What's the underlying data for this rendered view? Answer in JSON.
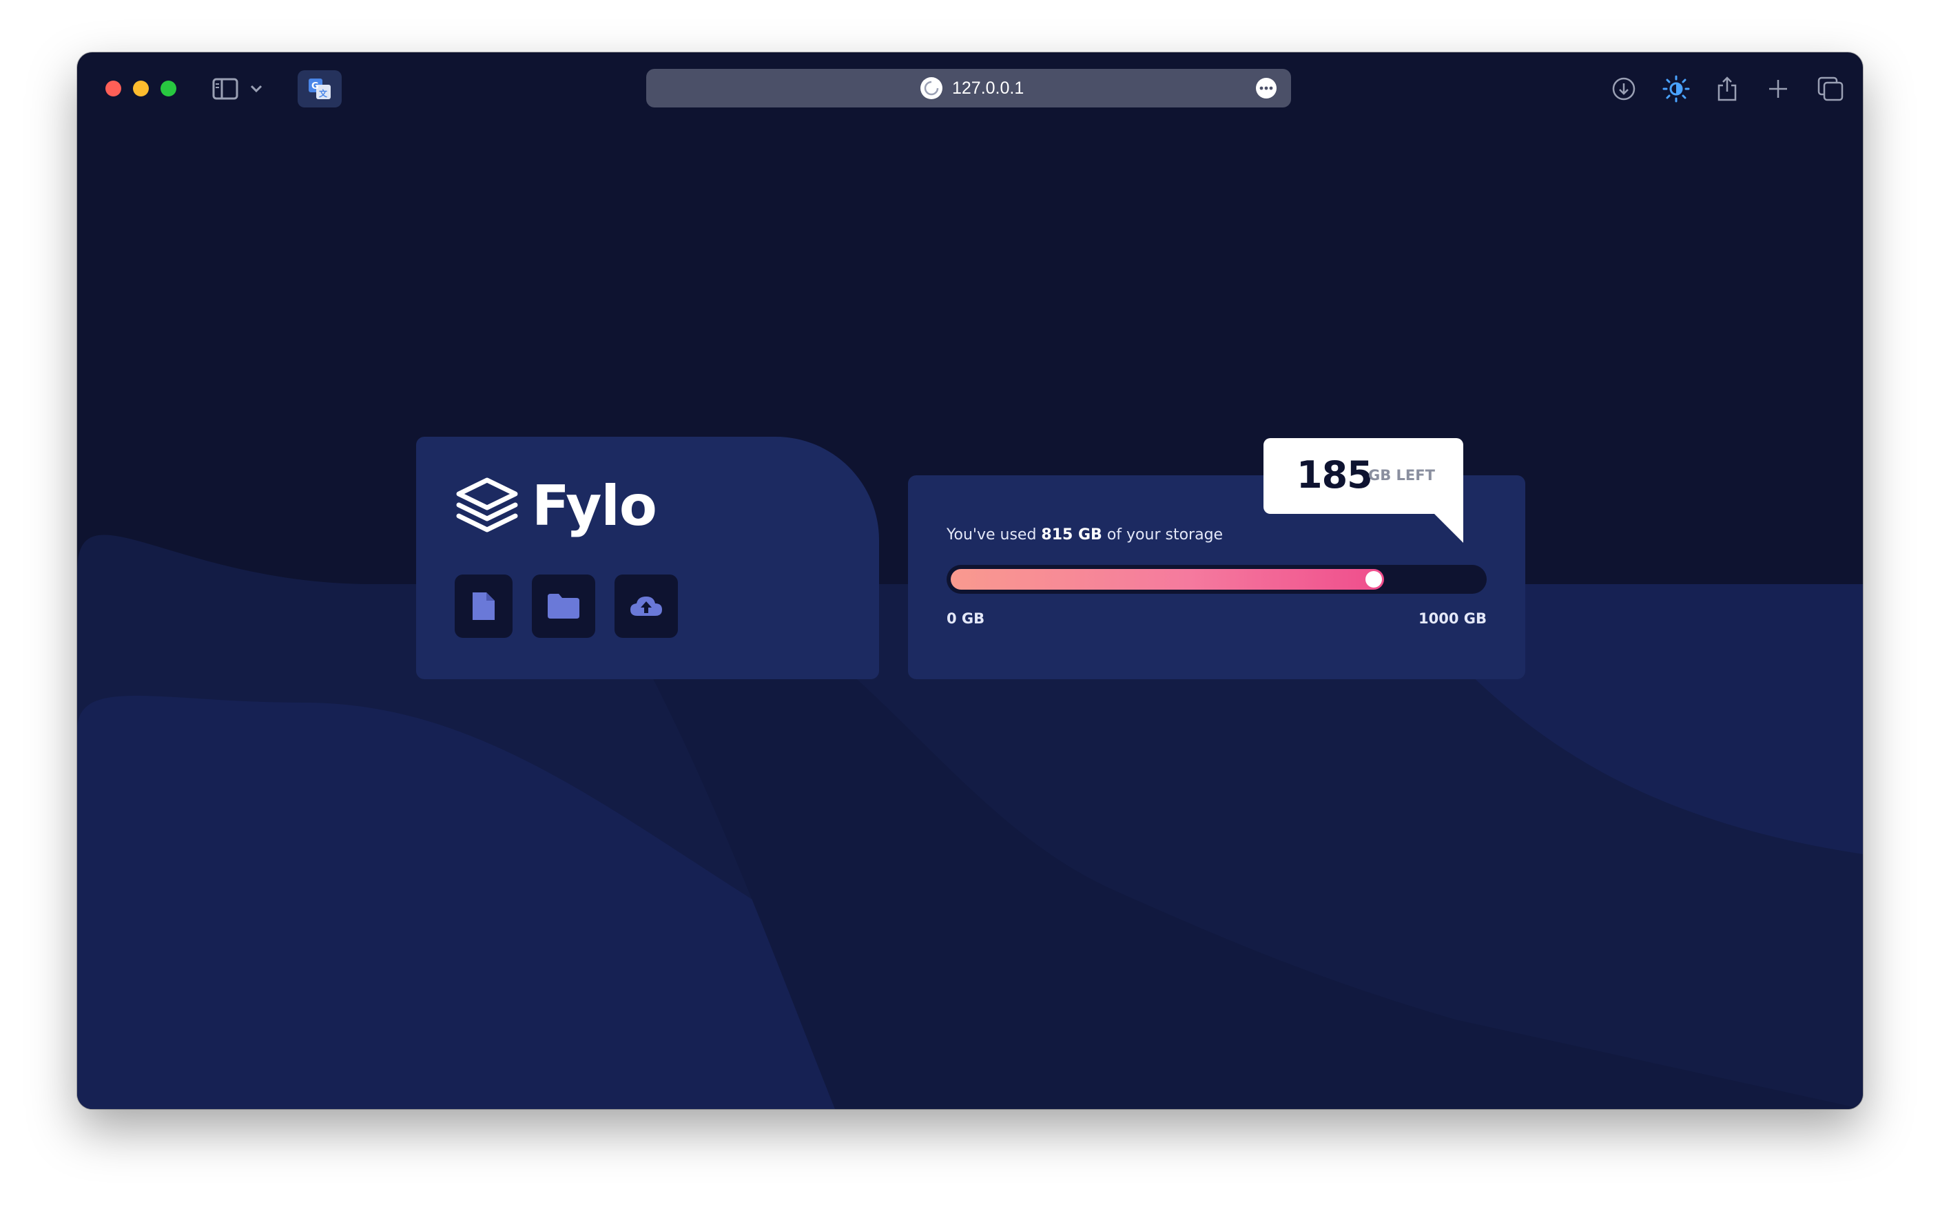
{
  "browser": {
    "url": "127.0.0.1",
    "icons": [
      "sidebar-icon",
      "chevron-down-icon",
      "translate-icon",
      "more-icon",
      "download-icon",
      "brightness-icon",
      "share-icon",
      "plus-icon",
      "tabs-icon"
    ]
  },
  "app": {
    "logo_text": "Fylo",
    "tiles": [
      "document-icon",
      "folder-icon",
      "upload-icon"
    ]
  },
  "storage": {
    "used_prefix": "You've used ",
    "used_amount": "815 GB",
    "used_suffix": " of your storage",
    "min_label": "0 GB",
    "max_label": "1000 GB",
    "used_fraction": 0.815,
    "remaining_number": "185",
    "remaining_unit": "GB LEFT"
  },
  "colors": {
    "background": "#0e1330",
    "card": "#1c2a61",
    "gradient_start": "#f99a8f",
    "gradient_end": "#ef4d8c",
    "tile_icon": "#6a79d8"
  }
}
